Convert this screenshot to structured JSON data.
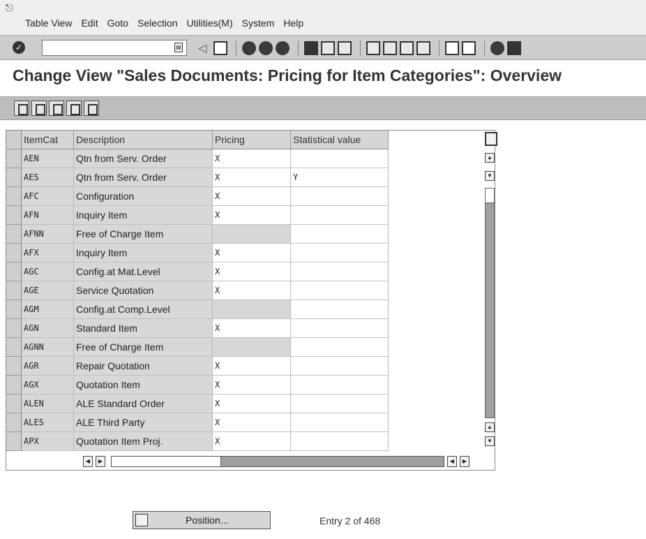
{
  "menu": {
    "items": [
      "Table View",
      "Edit",
      "Goto",
      "Selection",
      "Utilities(M)",
      "System",
      "Help"
    ]
  },
  "toolbar": {
    "command_field_value": "",
    "icons": [
      "enter-icon",
      "save-icon",
      "back-icon",
      "exit-icon",
      "cancel-icon",
      "print-icon",
      "find-icon",
      "find-next-icon",
      "first-page-icon",
      "previous-page-icon",
      "next-page-icon",
      "last-page-icon",
      "new-session-icon",
      "shortcut-icon",
      "help-icon",
      "layout-icon"
    ]
  },
  "page": {
    "title": "Change View \"Sales Documents: Pricing for Item Categories\": Overview"
  },
  "app_toolbar": {
    "icons": [
      "display-change-icon",
      "other-entry-icon",
      "select-all-icon",
      "select-block-icon",
      "deselect-all-icon"
    ]
  },
  "table": {
    "columns": [
      "ItemCat",
      "Description",
      "Pricing",
      "Statistical value"
    ],
    "rows": [
      {
        "itemcat": "AEN",
        "description": "Qtn from Serv. Order",
        "pricing": "X",
        "stat": ""
      },
      {
        "itemcat": "AES",
        "description": "Qtn from Serv. Order",
        "pricing": "X",
        "stat": "Y"
      },
      {
        "itemcat": "AFC",
        "description": "Configuration",
        "pricing": "X",
        "stat": ""
      },
      {
        "itemcat": "AFN",
        "description": "Inquiry Item",
        "pricing": "X",
        "stat": ""
      },
      {
        "itemcat": "AFNN",
        "description": "Free of Charge Item",
        "pricing": "",
        "stat": ""
      },
      {
        "itemcat": "AFX",
        "description": "Inquiry Item",
        "pricing": "X",
        "stat": ""
      },
      {
        "itemcat": "AGC",
        "description": "Config.at Mat.Level",
        "pricing": "X",
        "stat": ""
      },
      {
        "itemcat": "AGE",
        "description": "Service Quotation",
        "pricing": "X",
        "stat": ""
      },
      {
        "itemcat": "AGM",
        "description": "Config.at Comp.Level",
        "pricing": "",
        "stat": ""
      },
      {
        "itemcat": "AGN",
        "description": "Standard Item",
        "pricing": "X",
        "stat": ""
      },
      {
        "itemcat": "AGNN",
        "description": "Free of Charge Item",
        "pricing": "",
        "stat": ""
      },
      {
        "itemcat": "AGR",
        "description": "Repair Quotation",
        "pricing": "X",
        "stat": ""
      },
      {
        "itemcat": "AGX",
        "description": "Quotation Item",
        "pricing": "X",
        "stat": ""
      },
      {
        "itemcat": "ALEN",
        "description": "ALE Standard Order",
        "pricing": "X",
        "stat": ""
      },
      {
        "itemcat": "ALES",
        "description": "ALE Third Party",
        "pricing": "X",
        "stat": ""
      },
      {
        "itemcat": "APX",
        "description": "Quotation Item Proj.",
        "pricing": "X",
        "stat": ""
      }
    ]
  },
  "footer": {
    "position_label": "Position...",
    "entry_text": "Entry 2 of 468"
  }
}
